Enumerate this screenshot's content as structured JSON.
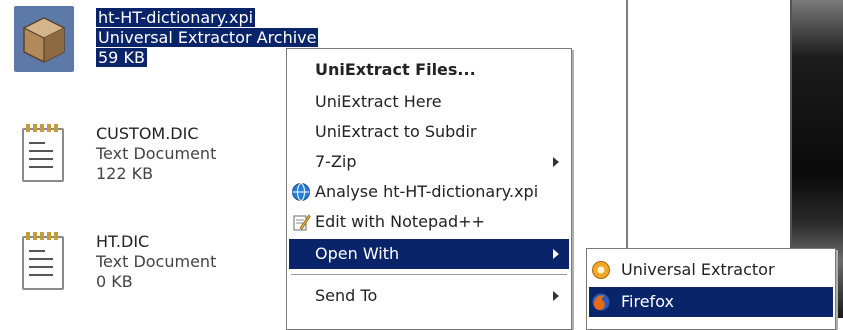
{
  "files": [
    {
      "name": "ht-HT-dictionary.xpi",
      "type": "Universal Extractor Archive",
      "size": "59 KB",
      "selected": true,
      "icon": "archive-box-icon"
    },
    {
      "name": "CUSTOM.DIC",
      "type": "Text Document",
      "size": "122 KB",
      "selected": false,
      "icon": "notepad-icon"
    },
    {
      "name": "HT.DIC",
      "type": "Text Document",
      "size": "0 KB",
      "selected": false,
      "icon": "notepad-icon"
    }
  ],
  "context_menu": {
    "items": [
      {
        "label": "UniExtract Files...",
        "bold": true
      },
      {
        "label": "UniExtract Here"
      },
      {
        "label": "UniExtract to Subdir"
      },
      {
        "label": "7-Zip",
        "submenu": true
      },
      {
        "label": "Analyse ht-HT-dictionary.xpi",
        "icon": "analyse-globe-icon"
      },
      {
        "label": "Edit with Notepad++",
        "icon": "notepad-plus-icon"
      },
      {
        "label": "Open With",
        "submenu": true,
        "highlighted": true
      },
      {
        "label": "Send To",
        "submenu": true
      }
    ]
  },
  "open_with_submenu": {
    "items": [
      {
        "label": "Universal Extractor",
        "icon": "universal-extractor-icon"
      },
      {
        "label": "Firefox",
        "icon": "firefox-icon",
        "highlighted": true
      }
    ]
  },
  "colors": {
    "selection": "#0a246a",
    "selected_icon_bg": "#5d79a8",
    "menu_bg": "#ffffff"
  }
}
